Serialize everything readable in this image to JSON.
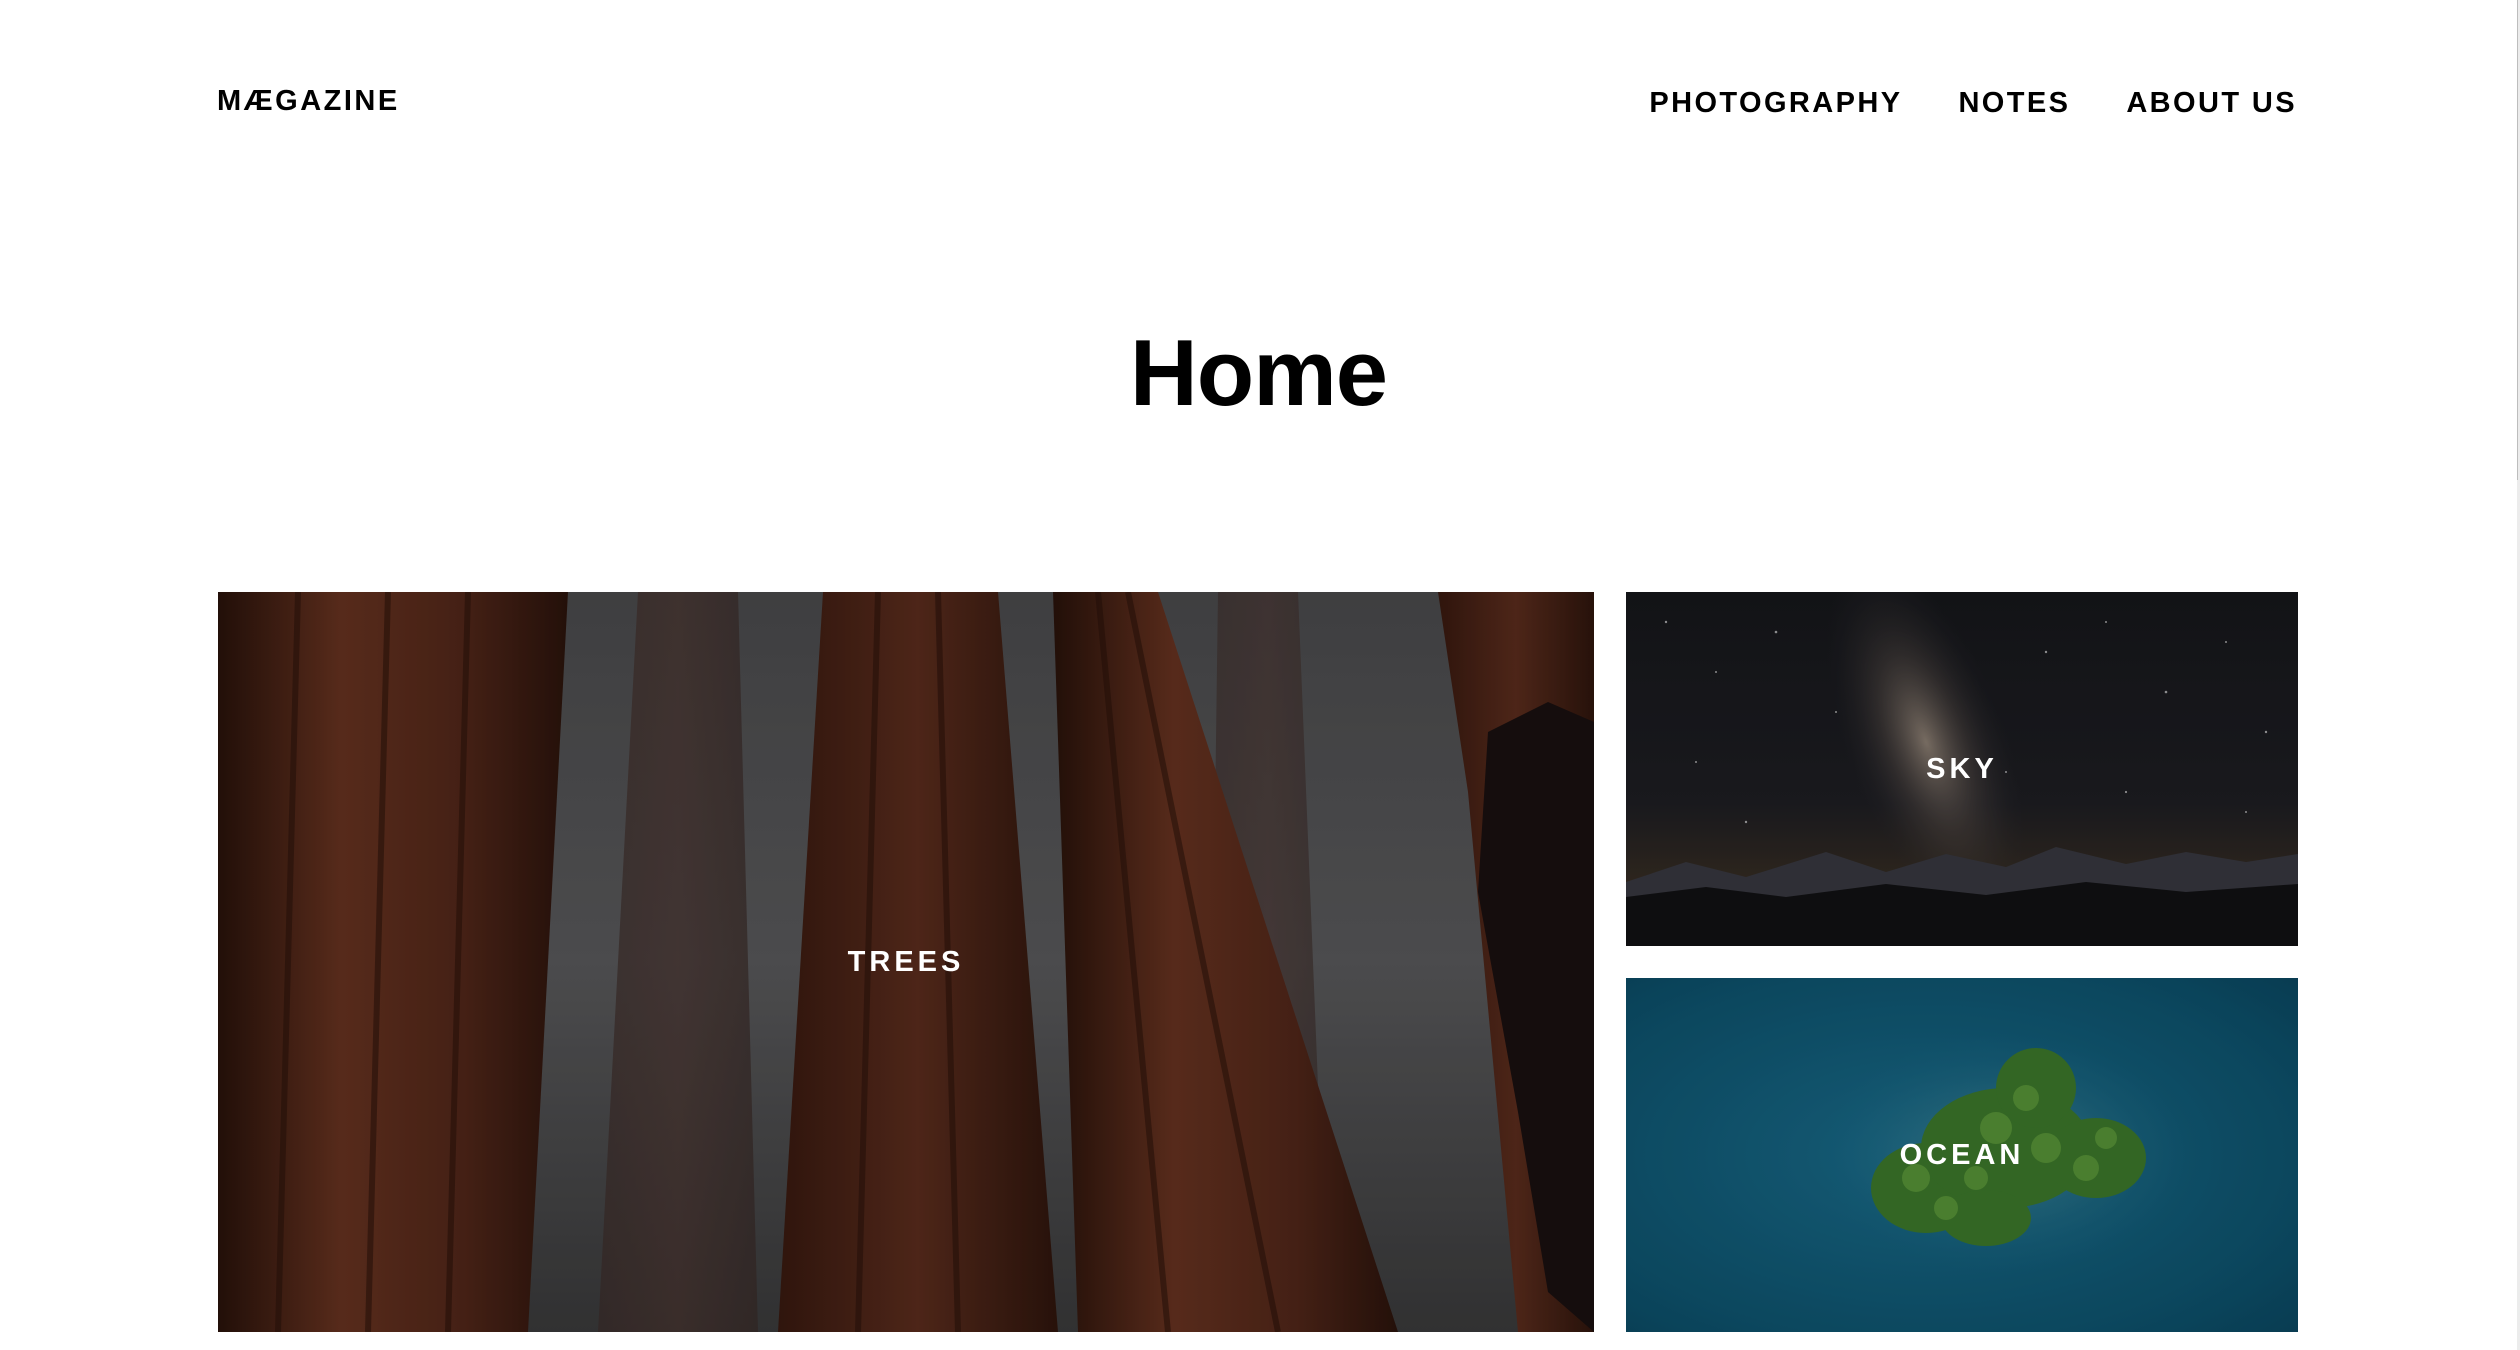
{
  "header": {
    "logo": "MÆGAZINE",
    "nav": [
      {
        "label": "PHOTOGRAPHY"
      },
      {
        "label": "NOTES"
      },
      {
        "label": "ABOUT US"
      }
    ]
  },
  "main": {
    "title": "Home",
    "tiles": [
      {
        "label": "TREES",
        "image": "redwood forest in fog"
      },
      {
        "label": "SKY",
        "image": "milky way over mountains"
      },
      {
        "label": "OCEAN",
        "image": "aerial island in blue water"
      }
    ]
  },
  "colors": {
    "background": "#ffffff",
    "text": "#000000",
    "tile_label": "#ffffff",
    "ocean": "#0d5a78",
    "sky": "#1b1c22",
    "trees": "#5a2c1c"
  }
}
